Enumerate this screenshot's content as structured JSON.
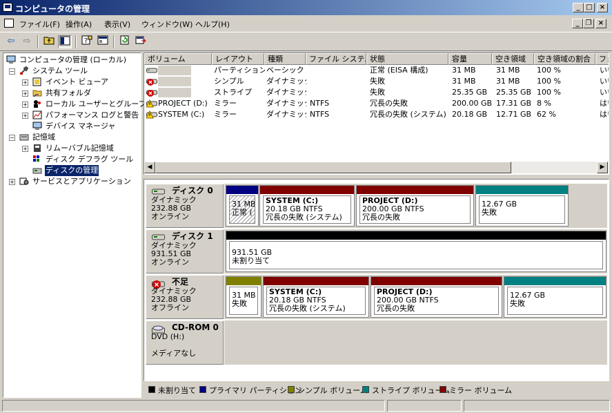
{
  "window": {
    "title": "コンピュータの管理"
  },
  "titlebar_buttons": {
    "minimize": "_",
    "maximize": "□",
    "close": "×"
  },
  "menu": {
    "items": [
      "ファイル(F)",
      "操作(A)",
      "表示(V)",
      "ウィンドウ(W)",
      "ヘルプ(H)"
    ]
  },
  "mdi_buttons": {
    "minimize": "_",
    "restore": "❐",
    "close": "×"
  },
  "toolbar": {
    "buttons": [
      "back-icon",
      "forward-icon",
      "up-folder-icon",
      "show-tree-icon",
      "properties-icon",
      "help-icon",
      "refresh-icon",
      "export-icon"
    ]
  },
  "tree": {
    "root": "コンピュータの管理 (ローカル)",
    "system_tools": "システム ツール",
    "event_viewer": "イベント ビューア",
    "shared_folders": "共有フォルダ",
    "local_users": "ローカル ユーザーとグループ",
    "perf_logs": "パフォーマンス ログと警告",
    "device_manager": "デバイス マネージャ",
    "storage": "記憶域",
    "removable_storage": "リムーバブル記憶域",
    "disk_defrag": "ディスク デフラグ ツール",
    "disk_management": "ディスクの管理",
    "services_apps": "サービスとアプリケーション"
  },
  "volume_list": {
    "columns": [
      "ボリューム",
      "レイアウト",
      "種類",
      "ファイル システム",
      "状態",
      "容量",
      "空き領域",
      "空き領域の割合",
      "フォ"
    ],
    "rows": [
      {
        "icon": "drive-icon",
        "volume": "",
        "layout": "パーティション",
        "type": "ベーシック",
        "fs": "",
        "status": "正常 (EISA 構成)",
        "capacity": "31 MB",
        "free": "31 MB",
        "pct": "100 %",
        "ft": "いい"
      },
      {
        "icon": "error-drive-icon",
        "volume": "",
        "layout": "シンプル",
        "type": "ダイナミック",
        "fs": "",
        "status": "失敗",
        "capacity": "31 MB",
        "free": "31 MB",
        "pct": "100 %",
        "ft": "いい"
      },
      {
        "icon": "error-drive-icon",
        "volume": "",
        "layout": "ストライプ",
        "type": "ダイナミック",
        "fs": "",
        "status": "失敗",
        "capacity": "25.35 GB",
        "free": "25.35 GB",
        "pct": "100 %",
        "ft": "いい"
      },
      {
        "icon": "warning-drive-icon",
        "volume": "PROJECT (D:)",
        "layout": "ミラー",
        "type": "ダイナミック",
        "fs": "NTFS",
        "status": "冗長の失敗",
        "capacity": "200.00 GB",
        "free": "17.31 GB",
        "pct": "8 %",
        "ft": "はい"
      },
      {
        "icon": "warning-drive-icon",
        "volume": "SYSTEM (C:)",
        "layout": "ミラー",
        "type": "ダイナミック",
        "fs": "NTFS",
        "status": "冗長の失敗 (システム)",
        "capacity": "20.18 GB",
        "free": "12.71 GB",
        "pct": "62 %",
        "ft": "はい"
      }
    ]
  },
  "disks": [
    {
      "name": "ディスク 0",
      "icon": "disk-icon",
      "kind": "ダイナミック",
      "size": "232.88 GB",
      "state": "オンライン",
      "volumes": [
        {
          "color": "#000080",
          "line1": "",
          "line2": "31 MB",
          "line3": "正常 (",
          "hatched": true
        },
        {
          "color": "#800000",
          "line1": "SYSTEM  (C:)",
          "line2": "20.18 GB NTFS",
          "line3": "冗長の失敗 (システム)"
        },
        {
          "color": "#800000",
          "line1": "PROJECT  (D:)",
          "line2": "200.00 GB NTFS",
          "line3": "冗長の失敗"
        },
        {
          "color": "#008080",
          "line1": "",
          "line2": "12.67 GB",
          "line3": "失敗"
        }
      ]
    },
    {
      "name": "ディスク 1",
      "icon": "disk-icon",
      "kind": "ダイナミック",
      "size": "931.51 GB",
      "state": "オンライン",
      "volumes": [
        {
          "color": "#000000",
          "line1": "",
          "line2": "931.51 GB",
          "line3": "未割り当て"
        }
      ]
    },
    {
      "name": "不足",
      "icon": "missing-disk-icon",
      "kind": "ダイナミック",
      "size": "232.88 GB",
      "state": "オフライン",
      "volumes": [
        {
          "color": "#808000",
          "line1": "",
          "line2": "31 MB",
          "line3": "失敗"
        },
        {
          "color": "#800000",
          "line1": "SYSTEM  (C:)",
          "line2": "20.18 GB NTFS",
          "line3": "冗長の失敗 (システム)"
        },
        {
          "color": "#800000",
          "line1": "PROJECT  (D:)",
          "line2": "200.00 GB NTFS",
          "line3": "冗長の失敗"
        },
        {
          "color": "#008080",
          "line1": "",
          "line2": "12.67 GB",
          "line3": "失敗"
        }
      ]
    },
    {
      "name": "CD-ROM 0",
      "icon": "cdrom-icon",
      "kind": "DVD (H:)",
      "size": "",
      "state": "メディアなし",
      "volumes": []
    }
  ],
  "legend": [
    {
      "color": "#000000",
      "label": "未割り当て"
    },
    {
      "color": "#000080",
      "label": "プライマリ パーティション"
    },
    {
      "color": "#808000",
      "label": "シンプル ボリューム"
    },
    {
      "color": "#008080",
      "label": "ストライプ ボリューム"
    },
    {
      "color": "#800000",
      "label": "ミラー ボリューム"
    }
  ]
}
